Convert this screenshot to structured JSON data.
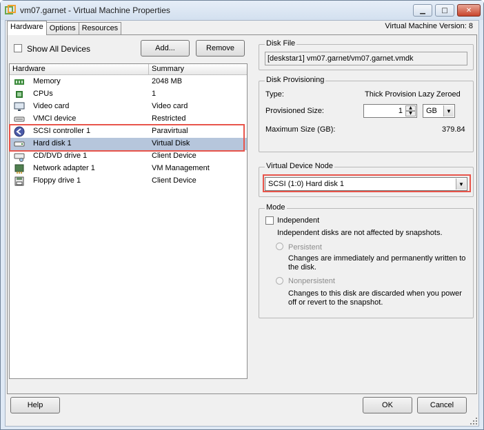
{
  "window": {
    "title": "vm07.garnet - Virtual Machine Properties",
    "minimize_glyph": "▁",
    "maximize_glyph": "□",
    "close_glyph": "✕"
  },
  "tabs": [
    "Hardware",
    "Options",
    "Resources"
  ],
  "vm_version": "Virtual Machine Version: 8",
  "hardware_panel": {
    "show_all_devices_label": "Show All Devices",
    "show_all_devices_checked": false,
    "add_button": "Add...",
    "remove_button": "Remove",
    "columns": [
      "Hardware",
      "Summary"
    ],
    "devices": [
      {
        "name": "Memory",
        "summary": "2048 MB",
        "icon": "memory-icon"
      },
      {
        "name": "CPUs",
        "summary": "1",
        "icon": "cpu-icon"
      },
      {
        "name": "Video card",
        "summary": "Video card",
        "icon": "monitor-icon"
      },
      {
        "name": "VMCI device",
        "summary": "Restricted",
        "icon": "vmci-icon"
      },
      {
        "name": "SCSI controller 1",
        "summary": "Paravirtual",
        "icon": "scsi-controller-icon"
      },
      {
        "name": "Hard disk 1",
        "summary": "Virtual Disk",
        "icon": "hard-disk-icon"
      },
      {
        "name": "CD/DVD drive 1",
        "summary": "Client Device",
        "icon": "cd-dvd-icon"
      },
      {
        "name": "Network adapter 1",
        "summary": "VM Management",
        "icon": "network-adapter-icon"
      },
      {
        "name": "Floppy drive 1",
        "summary": "Client Device",
        "icon": "floppy-icon"
      }
    ],
    "selected_device": "Hard disk 1"
  },
  "disk_file": {
    "legend": "Disk File",
    "value": "[deskstar1] vm07.garnet/vm07.garnet.vmdk"
  },
  "disk_provisioning": {
    "legend": "Disk Provisioning",
    "type_label": "Type:",
    "type_value": "Thick Provision Lazy Zeroed",
    "provisioned_label": "Provisioned Size:",
    "provisioned_value": "1",
    "unit": "GB",
    "max_label": "Maximum Size (GB):",
    "max_value": "379.84"
  },
  "virtual_device_node": {
    "legend": "Virtual Device Node",
    "selected": "SCSI (1:0) Hard disk 1"
  },
  "mode": {
    "legend": "Mode",
    "independent_label": "Independent",
    "independent_checked": false,
    "independent_desc": "Independent disks are not affected by snapshots.",
    "persistent_label": "Persistent",
    "persistent_desc_1": "Changes are immediately and permanently written to",
    "persistent_desc_2": "the disk.",
    "nonpersistent_label": "Nonpersistent",
    "nonpersistent_desc_1": "Changes to this disk are discarded when you power",
    "nonpersistent_desc_2": "off or revert to the snapshot."
  },
  "footer": {
    "help_button": "Help",
    "ok_button": "OK",
    "cancel_button": "Cancel"
  },
  "colors": {
    "highlight_border": "#e8544a",
    "selected_row": "#b6c6dc",
    "close_button": "#c8452c"
  }
}
